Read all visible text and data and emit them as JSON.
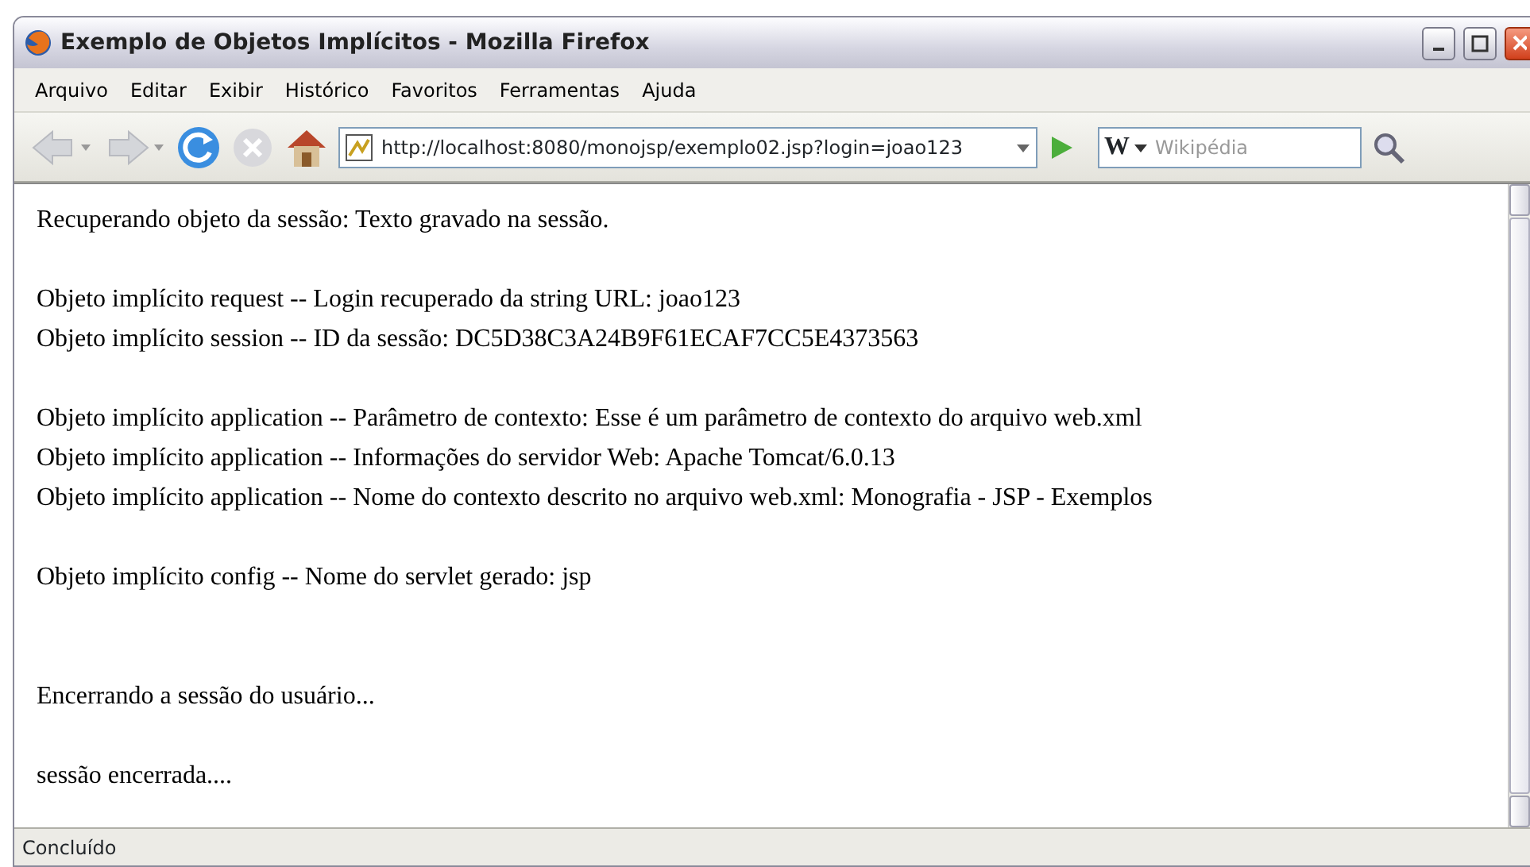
{
  "window": {
    "title": "Exemplo de Objetos Implícitos - Mozilla Firefox"
  },
  "menu": [
    {
      "label": "Arquivo"
    },
    {
      "label": "Editar"
    },
    {
      "label": "Exibir"
    },
    {
      "label": "Histórico"
    },
    {
      "label": "Favoritos"
    },
    {
      "label": "Ferramentas"
    },
    {
      "label": "Ajuda"
    }
  ],
  "toolbar": {
    "url": "http://localhost:8080/monojsp/exemplo02.jsp?login=joao123",
    "search_engine": "W",
    "search_placeholder": "Wikipédia"
  },
  "content": [
    {
      "kind": "text",
      "text": "Recuperando objeto da sessão: Texto gravado na sessão."
    },
    {
      "kind": "blank"
    },
    {
      "kind": "text",
      "text": "Objeto implícito request -- Login recuperado da string URL: joao123"
    },
    {
      "kind": "text",
      "text": "Objeto implícito session -- ID da sessão: DC5D38C3A24B9F61ECAF7CC5E4373563"
    },
    {
      "kind": "blank"
    },
    {
      "kind": "text",
      "text": "Objeto implícito application -- Parâmetro de contexto: Esse é um parâmetro de contexto do arquivo web.xml"
    },
    {
      "kind": "text",
      "text": "Objeto implícito application -- Informações do servidor Web: Apache Tomcat/6.0.13"
    },
    {
      "kind": "text",
      "text": "Objeto implícito application -- Nome do contexto descrito no arquivo web.xml: Monografia - JSP - Exemplos"
    },
    {
      "kind": "blank"
    },
    {
      "kind": "text",
      "text": "Objeto implícito config -- Nome do servlet gerado: jsp"
    },
    {
      "kind": "blank"
    },
    {
      "kind": "blank"
    },
    {
      "kind": "text",
      "text": "Encerrando a sessão do usuário..."
    },
    {
      "kind": "blank"
    },
    {
      "kind": "text",
      "text": "sessão encerrada...."
    }
  ],
  "status_bar": {
    "text": "Concluído"
  }
}
